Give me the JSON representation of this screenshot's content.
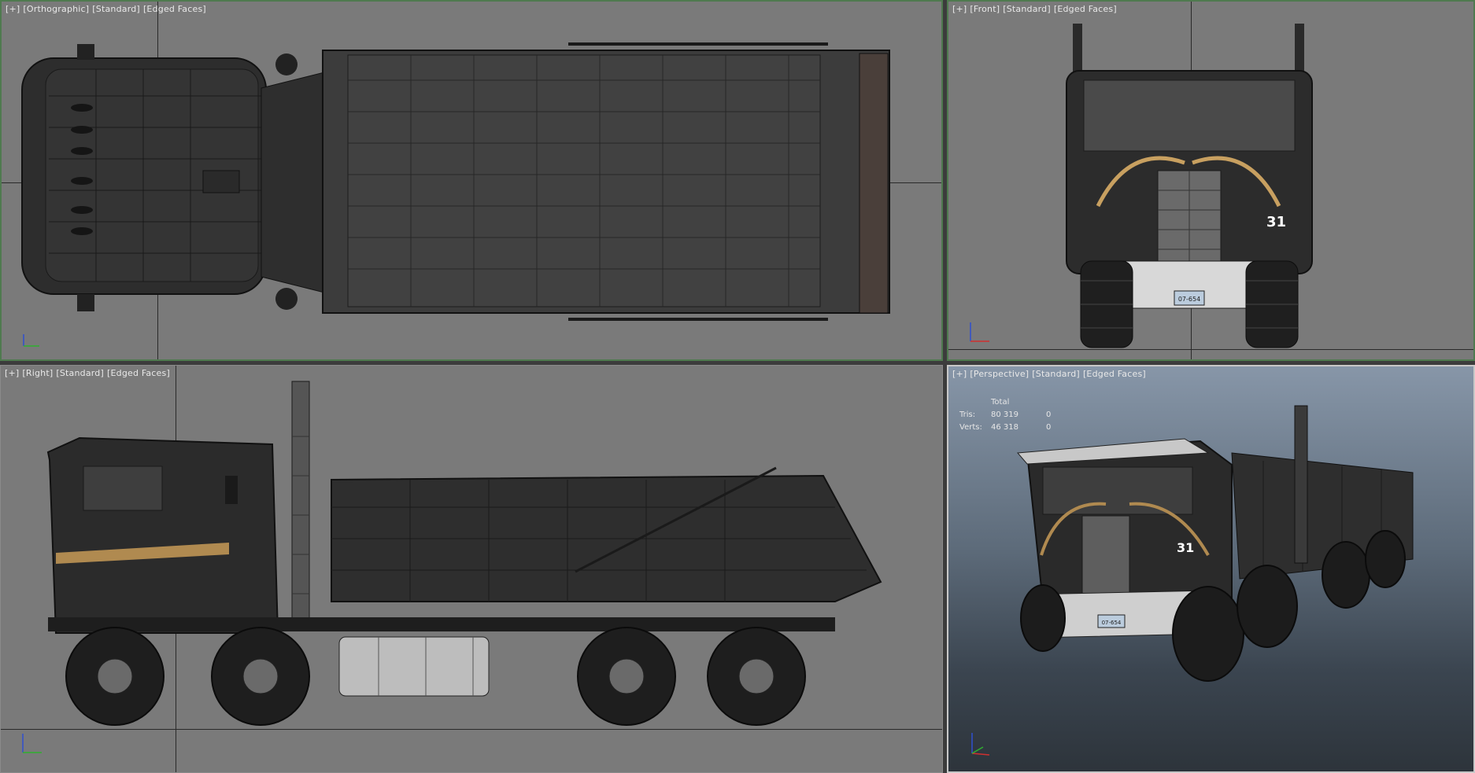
{
  "viewports": {
    "top": {
      "plus": "[+]",
      "view": "[Orthographic]",
      "shading": "[Standard]",
      "faces": "[Edged Faces]"
    },
    "front": {
      "plus": "[+]",
      "view": "[Front]",
      "shading": "[Standard]",
      "faces": "[Edged Faces]"
    },
    "right": {
      "plus": "[+]",
      "view": "[Right]",
      "shading": "[Standard]",
      "faces": "[Edged Faces]"
    },
    "persp": {
      "plus": "[+]",
      "view": "[Perspective]",
      "shading": "[Standard]",
      "faces": "[Edged Faces]"
    }
  },
  "stats": {
    "header": "Total",
    "tris_label": "Tris:",
    "tris_total": "80 319",
    "tris_sel": "0",
    "verts_label": "Verts:",
    "verts_total": "46 318",
    "verts_sel": "0"
  },
  "truck": {
    "number": "31",
    "plate": "07-654"
  },
  "axes": {
    "x": "x",
    "y": "y",
    "z": "z"
  },
  "colors": {
    "active_border": "#4f7a4f",
    "viewport_bg": "#7a7a7a",
    "axis_x": "#d03030",
    "axis_y": "#30b030",
    "axis_z": "#3050d0"
  }
}
